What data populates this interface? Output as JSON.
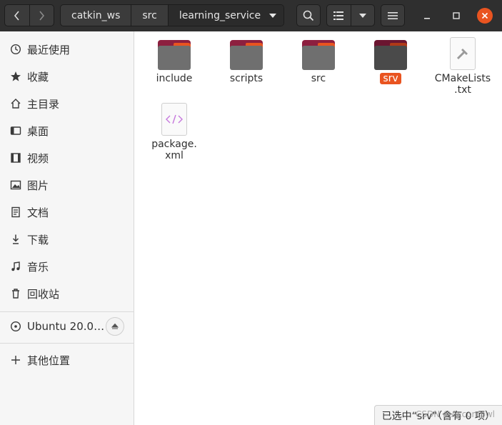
{
  "header": {
    "path": [
      "catkin_ws",
      "src",
      "learning_service"
    ]
  },
  "sidebar": {
    "items": [
      {
        "label": "最近使用",
        "icon": "clock-icon"
      },
      {
        "label": "收藏",
        "icon": "star-icon"
      },
      {
        "label": "主目录",
        "icon": "home-icon"
      },
      {
        "label": "桌面",
        "icon": "desktop-icon"
      },
      {
        "label": "视频",
        "icon": "video-icon"
      },
      {
        "label": "图片",
        "icon": "picture-icon"
      },
      {
        "label": "文档",
        "icon": "document-icon"
      },
      {
        "label": "下载",
        "icon": "download-icon"
      },
      {
        "label": "音乐",
        "icon": "music-icon"
      },
      {
        "label": "回收站",
        "icon": "trash-icon"
      }
    ],
    "device": {
      "label": "Ubuntu 20.0…",
      "icon": "disc-icon"
    },
    "other": {
      "label": "其他位置",
      "icon": "plus-icon"
    }
  },
  "files": [
    {
      "name": "include",
      "type": "folder"
    },
    {
      "name": "scripts",
      "type": "folder"
    },
    {
      "name": "src",
      "type": "folder"
    },
    {
      "name": "srv",
      "type": "folder",
      "selected": true
    },
    {
      "name": "CMakeLists\n.txt",
      "type": "text-file"
    },
    {
      "name": "package.\nxml",
      "type": "xml-file"
    }
  ],
  "status": {
    "text": "已选中“srv”（含有 0 项）",
    "watermark": "CSDN @Accompwl"
  },
  "colors": {
    "accent": "#e95420",
    "folder_tab": "#8d1f3f",
    "headerbar": "#2f2f2f"
  }
}
